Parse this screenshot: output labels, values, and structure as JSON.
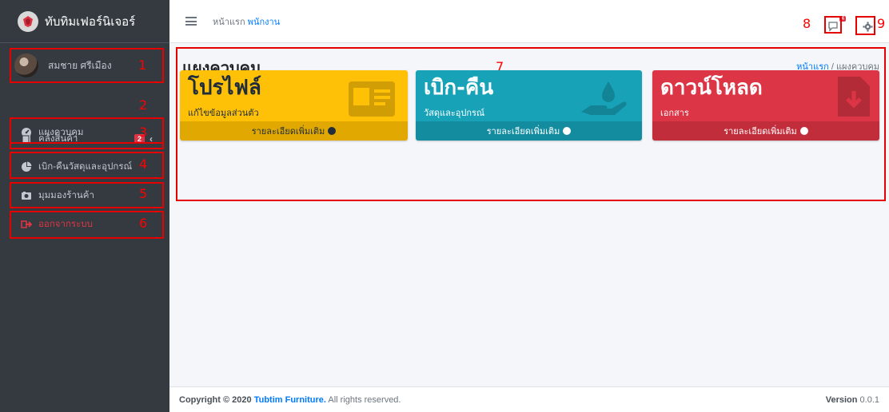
{
  "brand": {
    "name": "ทับทิมเฟอร์นิเจอร์"
  },
  "user": {
    "name": "สมชาย ศรีเมือง"
  },
  "sidebar": {
    "items": [
      {
        "label": "แผงควบคุม",
        "icon": "tachometer-icon"
      },
      {
        "label": "คลังสินค้า",
        "icon": "copy-icon",
        "badge": "2"
      },
      {
        "label": "เบิก-คืนวัสดุและอุปกรณ์",
        "icon": "pie-chart-icon"
      },
      {
        "label": "มุมมองร้านค้า",
        "icon": "camera-icon"
      },
      {
        "label": "ออกจากระบบ",
        "icon": "sign-out-icon"
      }
    ]
  },
  "topbar": {
    "home_label": "หน้าแรก",
    "employee_label": "พนักงาน",
    "messages_badge": "4"
  },
  "annotations": [
    "1",
    "2",
    "3",
    "4",
    "5",
    "6",
    "7",
    "8",
    "9"
  ],
  "page": {
    "title": "แผงควบคุม",
    "breadcrumb_home": "หน้าแรก",
    "breadcrumb_sep": "/",
    "breadcrumb_current": "แผงควบคุม"
  },
  "cards": [
    {
      "title": "โปรไฟล์",
      "subtitle": "แก้ไขข้อมูลส่วนตัว",
      "more": "รายละเอียดเพิ่มเติม",
      "icon": "id-card-icon",
      "color": "#ffc107"
    },
    {
      "title": "เบิก-คืน",
      "subtitle": "วัสดุและอุปกรณ์",
      "more": "รายละเอียดเพิ่มเติม",
      "icon": "hand-holding-water-icon",
      "color": "#17a2b8"
    },
    {
      "title": "ดาวน์โหลด",
      "subtitle": "เอกสาร",
      "more": "รายละเอียดเพิ่มเติม",
      "icon": "file-download-icon",
      "color": "#dc3545"
    }
  ],
  "footer": {
    "copyright": "Copyright © 2020",
    "brand": "Tubtim Furniture.",
    "rights": "All rights reserved.",
    "version_label": "Version",
    "version": "0.0.1"
  }
}
